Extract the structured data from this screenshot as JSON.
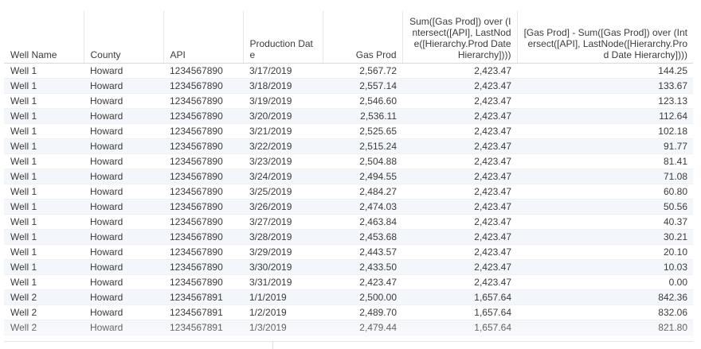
{
  "table": {
    "columns": [
      {
        "label": "Well Name",
        "align": "left"
      },
      {
        "label": "County",
        "align": "left"
      },
      {
        "label": "API",
        "align": "left"
      },
      {
        "label": "Production Date",
        "align": "left"
      },
      {
        "label": "Gas Prod",
        "align": "right"
      },
      {
        "label": "Sum([Gas Prod]) over (Intersect([API], LastNode([Hierarchy.Prod Date Hierarchy])))",
        "align": "right"
      },
      {
        "label": "[Gas Prod] - Sum([Gas Prod]) over (Intersect([API], LastNode([Hierarchy.Prod Date Hierarchy])))",
        "align": "right"
      }
    ],
    "rows": [
      [
        "Well 1",
        "Howard",
        "1234567890",
        "3/17/2019",
        "2,567.72",
        "2,423.47",
        "144.25"
      ],
      [
        "Well 1",
        "Howard",
        "1234567890",
        "3/18/2019",
        "2,557.14",
        "2,423.47",
        "133.67"
      ],
      [
        "Well 1",
        "Howard",
        "1234567890",
        "3/19/2019",
        "2,546.60",
        "2,423.47",
        "123.13"
      ],
      [
        "Well 1",
        "Howard",
        "1234567890",
        "3/20/2019",
        "2,536.11",
        "2,423.47",
        "112.64"
      ],
      [
        "Well 1",
        "Howard",
        "1234567890",
        "3/21/2019",
        "2,525.65",
        "2,423.47",
        "102.18"
      ],
      [
        "Well 1",
        "Howard",
        "1234567890",
        "3/22/2019",
        "2,515.24",
        "2,423.47",
        "91.77"
      ],
      [
        "Well 1",
        "Howard",
        "1234567890",
        "3/23/2019",
        "2,504.88",
        "2,423.47",
        "81.41"
      ],
      [
        "Well 1",
        "Howard",
        "1234567890",
        "3/24/2019",
        "2,494.55",
        "2,423.47",
        "71.08"
      ],
      [
        "Well 1",
        "Howard",
        "1234567890",
        "3/25/2019",
        "2,484.27",
        "2,423.47",
        "60.80"
      ],
      [
        "Well 1",
        "Howard",
        "1234567890",
        "3/26/2019",
        "2,474.03",
        "2,423.47",
        "50.56"
      ],
      [
        "Well 1",
        "Howard",
        "1234567890",
        "3/27/2019",
        "2,463.84",
        "2,423.47",
        "40.37"
      ],
      [
        "Well 1",
        "Howard",
        "1234567890",
        "3/28/2019",
        "2,453.68",
        "2,423.47",
        "30.21"
      ],
      [
        "Well 1",
        "Howard",
        "1234567890",
        "3/29/2019",
        "2,443.57",
        "2,423.47",
        "20.10"
      ],
      [
        "Well 1",
        "Howard",
        "1234567890",
        "3/30/2019",
        "2,433.50",
        "2,423.47",
        "10.03"
      ],
      [
        "Well 1",
        "Howard",
        "1234567890",
        "3/31/2019",
        "2,423.47",
        "2,423.47",
        "0.00"
      ],
      [
        "Well 2",
        "Howard",
        "1234567891",
        "1/1/2019",
        "2,500.00",
        "1,657.64",
        "842.36"
      ],
      [
        "Well 2",
        "Howard",
        "1234567891",
        "1/2/2019",
        "2,489.70",
        "1,657.64",
        "832.06"
      ],
      [
        "Well 2",
        "Howard",
        "1234567891",
        "1/3/2019",
        "2,479.44",
        "1,657.64",
        "821.80"
      ]
    ]
  }
}
